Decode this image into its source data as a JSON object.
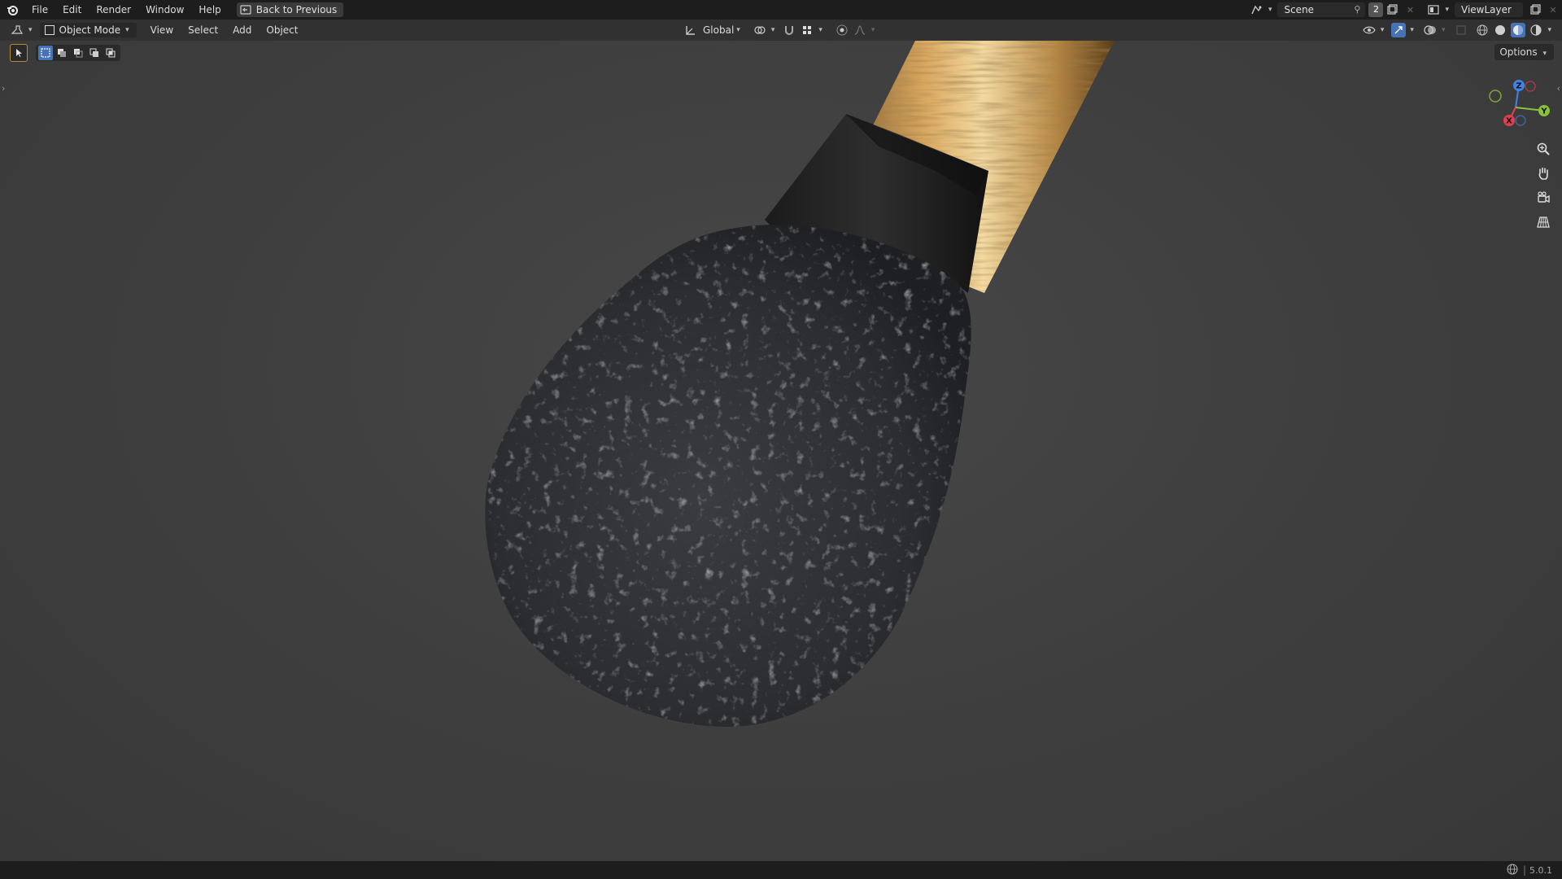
{
  "menu": {
    "items": [
      "File",
      "Edit",
      "Render",
      "Window",
      "Help"
    ],
    "back_button": "Back to Previous"
  },
  "scene": {
    "name": "Scene",
    "count": "2",
    "view_layer": "ViewLayer"
  },
  "viewport_header": {
    "mode": "Object Mode",
    "menus": [
      "View",
      "Select",
      "Add",
      "Object"
    ],
    "orientation": "Global"
  },
  "options_label": "Options",
  "gizmo": {
    "x": "X",
    "y": "Y",
    "z": "Z"
  },
  "status": {
    "version": "5.0.1"
  },
  "colors": {
    "x_axis": "#e0404b",
    "y_axis": "#8ac23c",
    "z_axis": "#3f82e8",
    "accent": "#4772b3"
  }
}
